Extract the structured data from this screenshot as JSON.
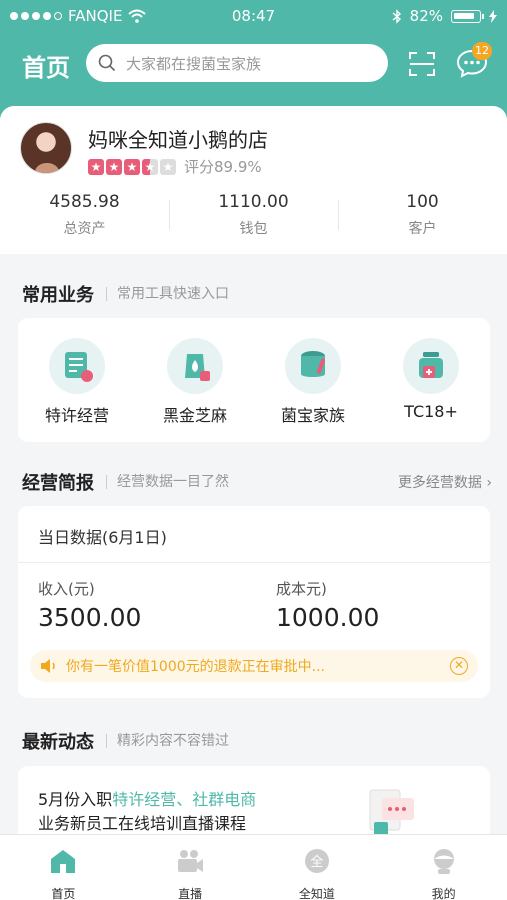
{
  "status_bar": {
    "carrier": "FANQIE",
    "time": "08:47",
    "battery": "82%"
  },
  "header": {
    "title": "首页",
    "search_placeholder": "大家都在搜菌宝家族",
    "message_badge": "12"
  },
  "profile": {
    "shop_name": "妈咪全知道小鹅的店",
    "rating_label": "评分89.9%",
    "rating_stars": 3.5,
    "stats": [
      {
        "value": "4585.98",
        "label": "总资产"
      },
      {
        "value": "1110.00",
        "label": "钱包"
      },
      {
        "value": "100",
        "label": "客户"
      }
    ]
  },
  "services_section": {
    "title": "常用业务",
    "subtitle": "常用工具快速入口",
    "items": [
      {
        "label": "特许经营",
        "icon": "document-icon"
      },
      {
        "label": "黑金芝麻",
        "icon": "seed-bag-icon"
      },
      {
        "label": "菌宝家族",
        "icon": "tube-icon"
      },
      {
        "label": "TC18+",
        "icon": "jar-icon"
      }
    ]
  },
  "report_section": {
    "title": "经营简报",
    "subtitle": "经营数据一目了然",
    "more": "更多经营数据",
    "date": "当日数据(6月1日)",
    "income_label": "收入(元)",
    "income_value": "3500.00",
    "cost_label": "成本元)",
    "cost_value": "1000.00",
    "notice": "你有一笔价值1000元的退款正在审批中..."
  },
  "news_section": {
    "title": "最新动态",
    "subtitle": "精彩内容不容错过",
    "line1_prefix": "5月份入职",
    "line1_highlight": "特许经营、社群电商",
    "line2": "业务新员工在线培训直播课程"
  },
  "tabbar": {
    "items": [
      {
        "label": "首页",
        "icon": "home-icon"
      },
      {
        "label": "直播",
        "icon": "video-camera-icon"
      },
      {
        "label": "全知道",
        "icon": "knowledge-icon"
      },
      {
        "label": "我的",
        "icon": "profile-icon"
      }
    ]
  },
  "colors": {
    "accent": "#4fb8a9",
    "warning": "#f0a91e",
    "star": "#e85d78",
    "badge": "#f5a623"
  }
}
